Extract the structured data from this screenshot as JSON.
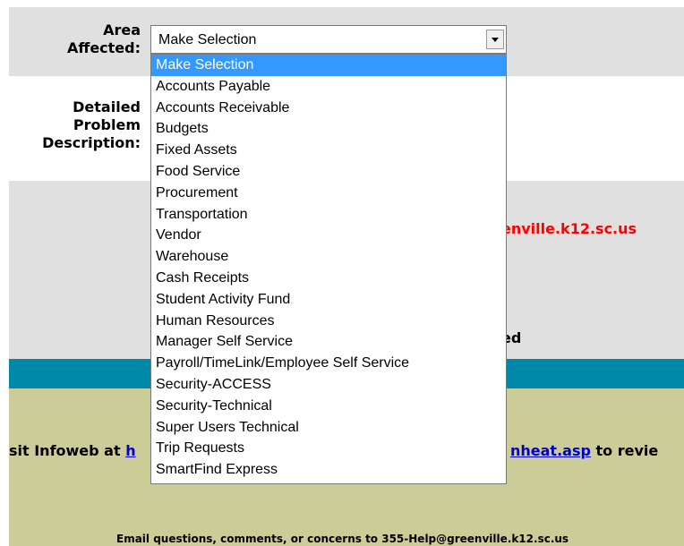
{
  "form": {
    "area_label_line1": "Area",
    "area_label_line2": "Affected:",
    "desc_label_line1": "Detailed",
    "desc_label_line2": "Problem",
    "desc_label_line3": "Description:",
    "select_value": "Make Selection",
    "options": [
      "Make Selection",
      "Accounts Payable",
      "Accounts Receivable",
      "Budgets",
      "Fixed Assets",
      "Food Service",
      "Procurement",
      "Transportation",
      "Vendor",
      "Warehouse",
      "Cash Receipts",
      "Student Activity Fund",
      "Human Resources",
      "Manager Self Service",
      "Payroll/TimeLink/Employee Self Service",
      "Security-ACCESS",
      "Security-Technical",
      "Super Users Technical",
      "Trip Requests",
      "SmartFind Express"
    ]
  },
  "info": {
    "red_text": "enville.k12.sc.us",
    "ed_text": "ed"
  },
  "footer": {
    "left_text": "sit Infoweb at ",
    "left_link": "h",
    "right_link": "nheat.asp",
    "right_text": " to revie",
    "email_line": "Email questions, comments, or concerns to 355-Help@greenville.k12.sc.us"
  },
  "colors": {
    "selected_highlight": "#3399ff",
    "teal_bar": "#0088a8",
    "footer_bg": "#cccc99",
    "red_text": "#ff0000"
  }
}
